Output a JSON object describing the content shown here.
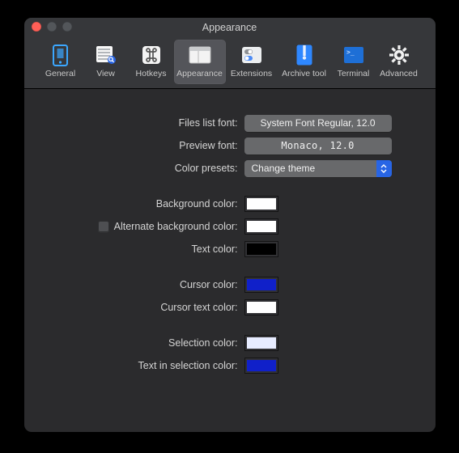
{
  "window": {
    "title": "Appearance"
  },
  "tabs": {
    "general": {
      "label": "General"
    },
    "view": {
      "label": "View"
    },
    "hotkeys": {
      "label": "Hotkeys"
    },
    "appearance": {
      "label": "Appearance"
    },
    "extensions": {
      "label": "Extensions"
    },
    "archive": {
      "label": "Archive tool"
    },
    "terminal": {
      "label": "Terminal"
    },
    "advanced": {
      "label": "Advanced"
    }
  },
  "rows": {
    "files_list_font": {
      "label": "Files list font:",
      "value": "System Font Regular, 12.0"
    },
    "preview_font": {
      "label": "Preview font:",
      "value": "Monaco, 12.0"
    },
    "color_presets": {
      "label": "Color presets:",
      "value": "Change theme"
    },
    "background": {
      "label": "Background color:",
      "color": "#ffffff"
    },
    "alt_background": {
      "label": "Alternate background color:",
      "color": "#ffffff"
    },
    "text": {
      "label": "Text color:",
      "color": "#000000"
    },
    "cursor": {
      "label": "Cursor color:",
      "color": "#1020c9"
    },
    "cursor_text": {
      "label": "Cursor text color:",
      "color": "#ffffff"
    },
    "selection": {
      "label": "Selection color:",
      "color": "#e7ecff"
    },
    "text_in_selection": {
      "label": "Text in selection color:",
      "color": "#1020c9"
    }
  }
}
